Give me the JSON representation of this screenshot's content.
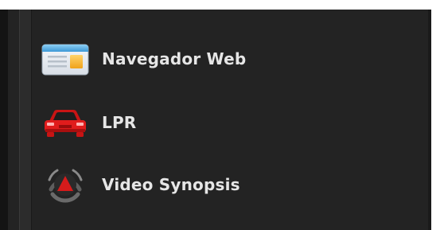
{
  "menu": {
    "items": [
      {
        "label": "Navegador Web",
        "icon": "web-browser-icon"
      },
      {
        "label": "LPR",
        "icon": "car-icon"
      },
      {
        "label": "Video Synopsis",
        "icon": "synopsis-icon"
      }
    ]
  },
  "colors": {
    "panel_bg": "#232323",
    "text": "#e6e6e6",
    "accent_red": "#d61b1b"
  }
}
